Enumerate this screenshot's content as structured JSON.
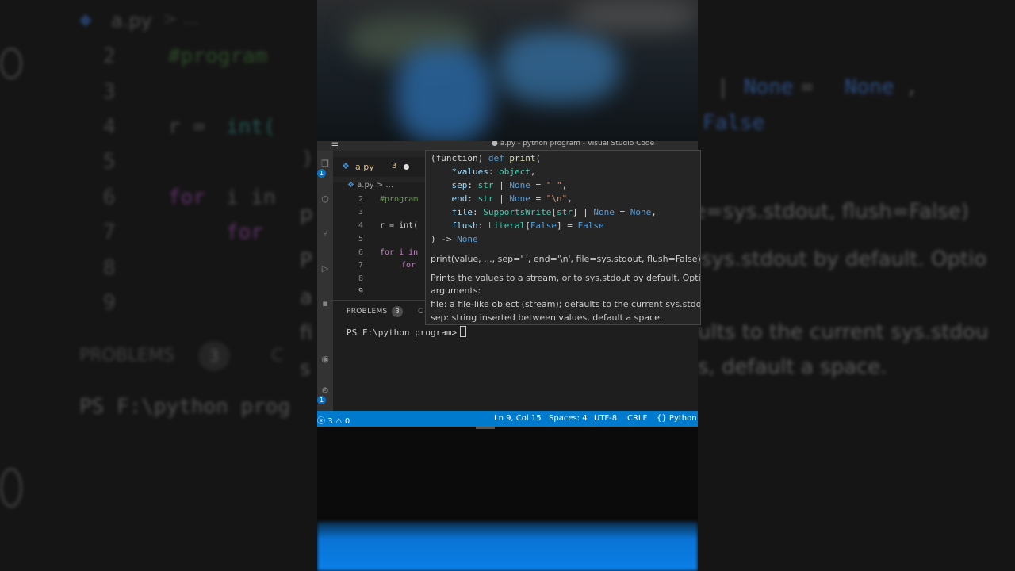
{
  "window": {
    "title": "● a.py - python program - Visual Studio Code",
    "menu_icon": "hamburger-icon"
  },
  "tab": {
    "filename": "a.py",
    "problem_count": "3"
  },
  "breadcrumb": {
    "file": "a.py",
    "sep": ">",
    "more": "..."
  },
  "activity_badges": {
    "explorer": "1",
    "accounts": "1"
  },
  "editor": {
    "lines": [
      {
        "num": "2",
        "text": "#program"
      },
      {
        "num": "3",
        "text": ""
      },
      {
        "num": "4",
        "text": "r = int("
      },
      {
        "num": "5",
        "text": ""
      },
      {
        "num": "6",
        "text": "for i in"
      },
      {
        "num": "7",
        "text": "for"
      },
      {
        "num": "8",
        "text": ""
      },
      {
        "num": "9",
        "text": ""
      }
    ]
  },
  "hover": {
    "signature": {
      "l1_prefix": "(function) ",
      "l1_kw": "def",
      "l1_fn": "print",
      "l1_suffix": "(",
      "l2_param": "*values",
      "l2_type": "object",
      "l3_param": "sep",
      "l3_type": "str",
      "l3_none": "None",
      "l3_default": "\" \"",
      "l4_param": "end",
      "l4_type": "str",
      "l4_none": "None",
      "l4_default": "\"\\n\"",
      "l5_param": "file",
      "l5_type": "SupportsWrite",
      "l5_typearg": "str",
      "l5_none": "None",
      "l5_default": "None",
      "l6_param": "flush",
      "l6_type": "Literal",
      "l6_typearg": "False",
      "l6_default": "False",
      "l7_ret": "None"
    },
    "doc": {
      "usage": "print(value, ..., sep=' ', end='\\n', file=sys.stdout, flush=False)",
      "desc1": "Prints the values to a stream, or to sys.stdout by default. Optio",
      "desc2": "arguments:",
      "file_desc": "file: a file-like object (stream); defaults to the current sys.stdou",
      "sep_desc": "sep: string inserted between values, default a space."
    }
  },
  "panel": {
    "tab_label": "PROBLEMS",
    "badge": "3",
    "next_tab": "C"
  },
  "terminal": {
    "prompt": "PS F:\\python program>"
  },
  "statusbar": {
    "errors": "3",
    "warnings": "0",
    "position": "Ln 9, Col 15",
    "spaces": "Spaces: 4",
    "encoding": "UTF-8",
    "eol": "CRLF",
    "language": "Python"
  },
  "background": {
    "left_tab": "a.py",
    "left_crumb": "> ...",
    "left_lines": [
      "2",
      "3",
      "4",
      "5",
      "6",
      "7",
      "8",
      "9"
    ],
    "left_code_2": "#program",
    "left_code_4a": "r = ",
    "left_code_4b": "int(",
    "left_code_6a": "for ",
    "left_code_6b": "i in",
    "left_code_7": "for",
    "left_code_5": ")",
    "left_panel": "PROBLEMS",
    "left_badge": "3",
    "left_panel_next": "C",
    "left_term": "PS F:\\python prog",
    "left_side_p": "p",
    "left_side_pp": "P",
    "left_side_a": "a",
    "left_side_fi": "fi",
    "left_side_s": "s",
    "right_l1a": "| ",
    "right_l1b": "None",
    "right_l1c": " = ",
    "right_l1d": "None",
    "right_l1e": ",",
    "right_l2": "False",
    "right_l3": "e=sys.stdout, flush=False)",
    "right_l4": "sys.stdout by default. Optio",
    "right_l5": "ults to the current sys.stdou",
    "right_l6": "s, default a space."
  }
}
